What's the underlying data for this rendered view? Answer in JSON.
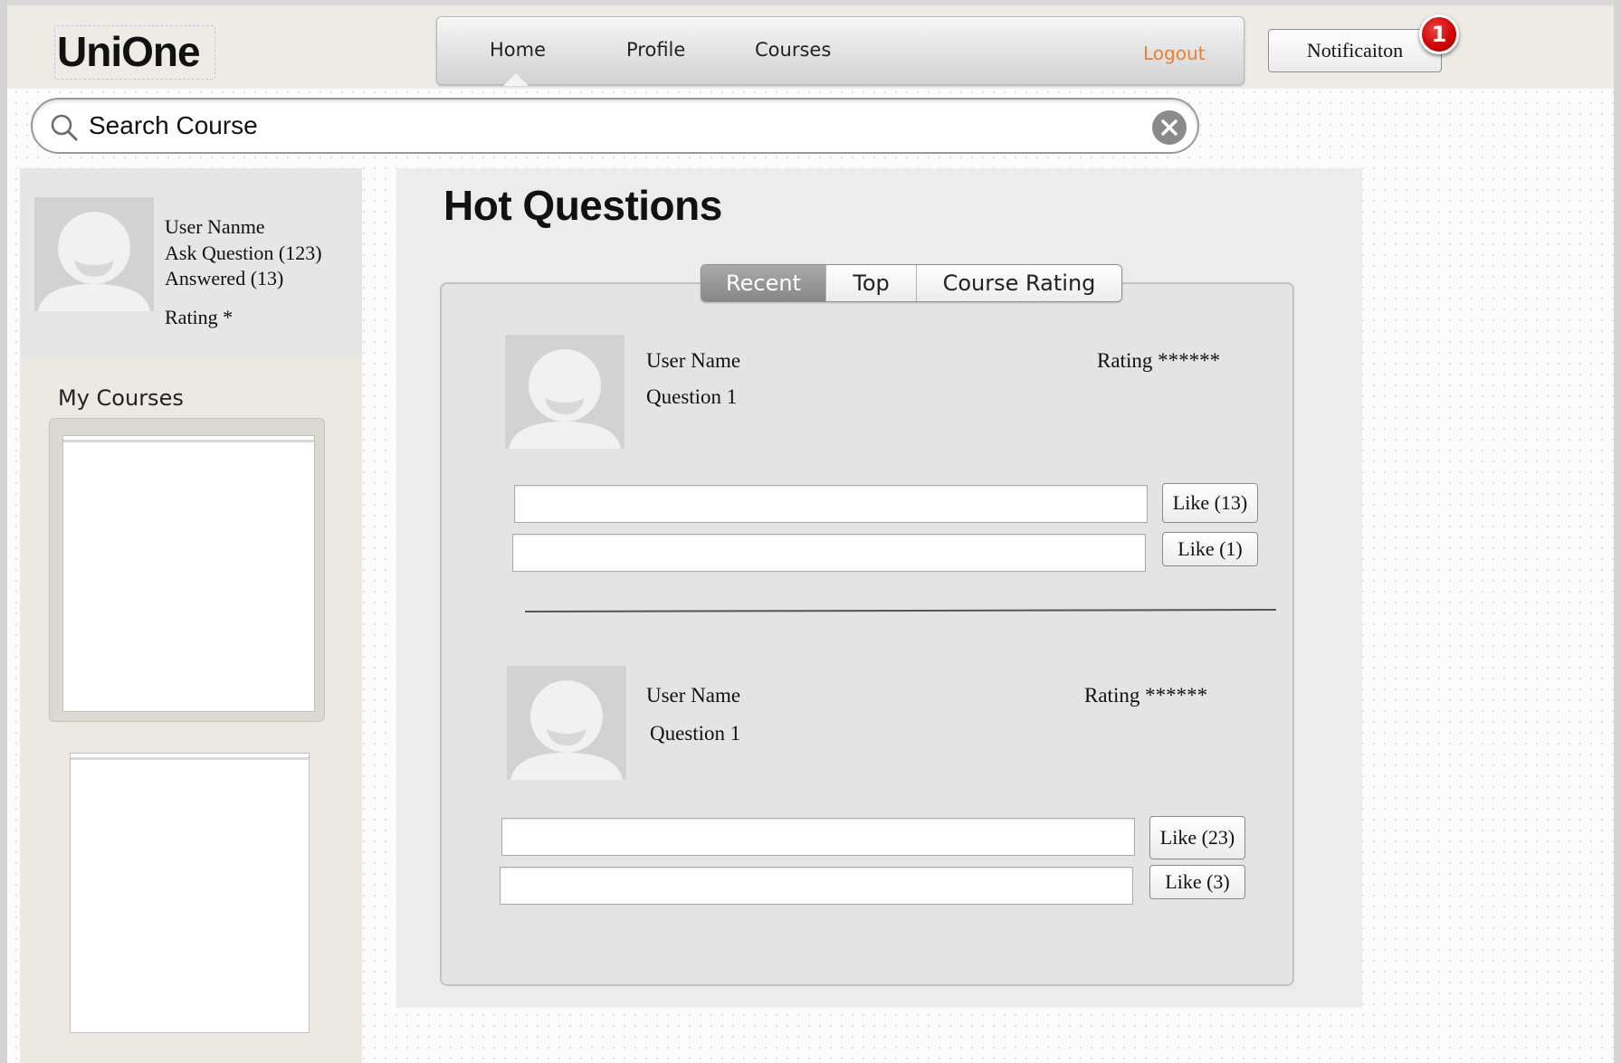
{
  "header": {
    "logo": "UniOne",
    "nav": {
      "home": "Home",
      "profile": "Profile",
      "courses": "Courses",
      "logout": "Logout"
    },
    "notification_label": "Notificaiton",
    "notification_count": "1"
  },
  "search": {
    "placeholder": "Search Course"
  },
  "sidebar": {
    "user_name": "User Nanme",
    "ask_question": "Ask Question (123)",
    "answered": "Answered (13)",
    "rating": "Rating *",
    "my_courses_title": "My Courses"
  },
  "main": {
    "title": "Hot Questions",
    "tabs": [
      "Recent",
      "Top",
      "Course Rating"
    ],
    "active_tab": "Recent",
    "questions": [
      {
        "user": "User Name",
        "question": "Question 1",
        "rating": "Rating ******",
        "answers": [
          {
            "like": "Like (13)"
          },
          {
            "like": "Like (1)"
          }
        ]
      },
      {
        "user": "User Name",
        "question": "Question 1",
        "rating": "Rating ******",
        "answers": [
          {
            "like": "Like (23)"
          },
          {
            "like": "Like (3)"
          }
        ]
      }
    ]
  },
  "colors": {
    "logout": "#ee7f2d",
    "badge": "#cc0000",
    "active_tab": "#8f8f8f"
  },
  "icons": {
    "search": "search-icon",
    "clear": "close-icon",
    "avatar": "user-avatar-icon"
  }
}
